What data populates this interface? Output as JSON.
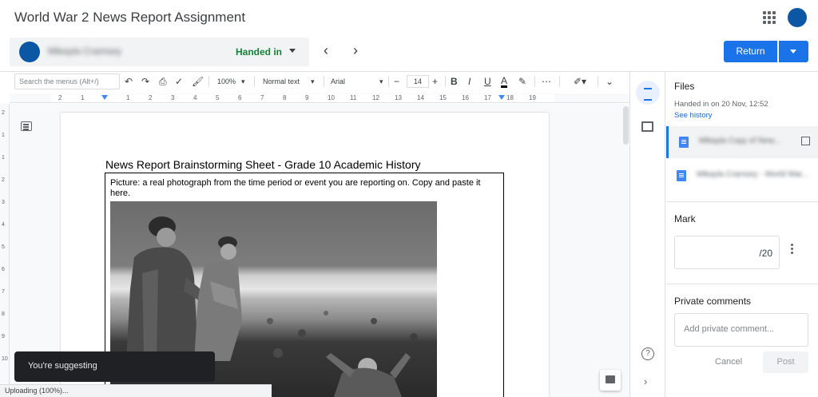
{
  "header": {
    "title": "World War 2 News Report Assignment"
  },
  "student": {
    "name": "Mikayla Cramsey",
    "status": "Handed in"
  },
  "actions": {
    "return_label": "Return"
  },
  "toolbar": {
    "search_placeholder": "Search the menus (Alt+/)",
    "zoom": "100%",
    "style": "Normal text",
    "font": "Arial",
    "font_size": "14",
    "bold": "B",
    "italic": "I",
    "underline": "U",
    "text_color": "A"
  },
  "ruler": {
    "marks": [
      "2",
      "1",
      "1",
      "2",
      "3",
      "4",
      "5",
      "6",
      "7",
      "8",
      "9",
      "10",
      "11",
      "12",
      "13",
      "14",
      "15",
      "16",
      "17",
      "18",
      "19"
    ]
  },
  "vruler": {
    "marks": [
      "2",
      "1",
      "1",
      "2",
      "3",
      "4",
      "5",
      "6",
      "7",
      "8",
      "9",
      "10"
    ]
  },
  "document": {
    "heading": "News Report Brainstorming Sheet - Grade 10 Academic History",
    "picture_prompt": "Picture: a real photograph from the time period or event you are reporting on. Copy and paste it here."
  },
  "toast": {
    "text": "You're suggesting"
  },
  "upload": {
    "text": "Uploading (100%)..."
  },
  "panel": {
    "files_title": "Files",
    "handed_on": "Handed in on 20 Nov, 12:52",
    "see_history": "See history",
    "files": [
      {
        "name": "Mikayla Copy of New..."
      },
      {
        "name": "Mikayla Cramsey - World War..."
      }
    ],
    "mark_title": "Mark",
    "mark_value": "/20",
    "comments_title": "Private comments",
    "comment_placeholder": "Add private comment...",
    "cancel_label": "Cancel",
    "post_label": "Post"
  },
  "colors": {
    "accent": "#1a73e8",
    "status_green": "#188038",
    "avatar": "#0b57a4"
  }
}
